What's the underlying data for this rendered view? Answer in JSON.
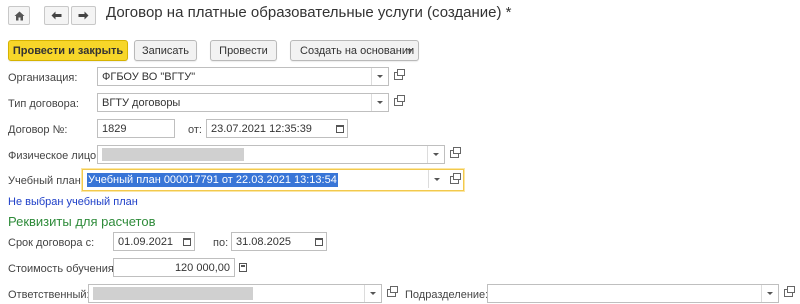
{
  "nav": {
    "home_icon": "home-icon",
    "back_icon": "arrow-left-icon",
    "forward_icon": "arrow-right-icon"
  },
  "title": "Договор на платные образовательные услуги (создание) *",
  "toolbar": {
    "post_close_label": "Провести и закрыть",
    "save_label": "Записать",
    "post_label": "Провести",
    "create_based_label": "Создать на основании"
  },
  "form": {
    "org_label": "Организация:",
    "org_value": "ФГБОУ ВО \"ВГТУ\"",
    "contract_type_label": "Тип договора:",
    "contract_type_value": "ВГТУ договоры",
    "contract_no_label": "Договор №:",
    "contract_no_value": "1829",
    "date_from_label": "от:",
    "date_from_value": "23.07.2021 12:35:39",
    "person_label": "Физическое лицо:",
    "plan_label": "Учебный план:",
    "plan_value": "Учебный план 000017791 от 22.03.2021 13:13:54",
    "plan_warning": "Не выбран учебный план"
  },
  "payment": {
    "section_title": "Реквизиты для расчетов",
    "term_label": "Срок договора с:",
    "term_from": "01.09.2021",
    "term_to_label": "по:",
    "term_to": "31.08.2025",
    "cost_label": "Стоимость обучения:",
    "cost_value": "120 000,00",
    "responsible_label": "Ответственный:",
    "department_label": "Подразделение:"
  },
  "colors": {
    "primary_button": "#f7d629",
    "section_title": "#2e8b3a",
    "warning_link": "#1f40c8",
    "selection": "#3875d7"
  }
}
